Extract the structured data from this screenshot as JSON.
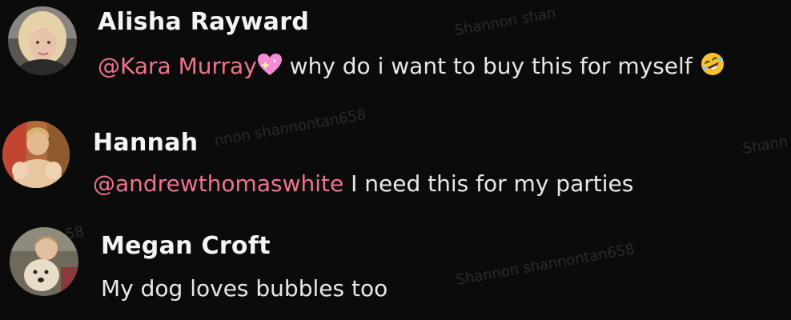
{
  "comments": [
    {
      "username": "Alisha Rayward",
      "mention": "@Kara Murray",
      "mention_emoji": "sparkling-heart-icon",
      "text": " why do i want to buy this for myself ",
      "trailing_emoji": "rolling-on-floor-laughing-icon"
    },
    {
      "username": "Hannah",
      "mention": "@andrewthomaswhite",
      "text": " I need this for my parties"
    },
    {
      "username": "Megan Croft",
      "text": "My dog loves bubbles too"
    }
  ],
  "watermarks": {
    "w1": "Shannon shan",
    "w2": "nnon shannontan658",
    "w3": "Shann",
    "w4": "Shannon shannontan658",
    "w5": "58"
  },
  "colors": {
    "background": "#0b0b0c",
    "mention": "#f0728b",
    "username": "#f4f4f4",
    "text": "#e8e8e8"
  }
}
